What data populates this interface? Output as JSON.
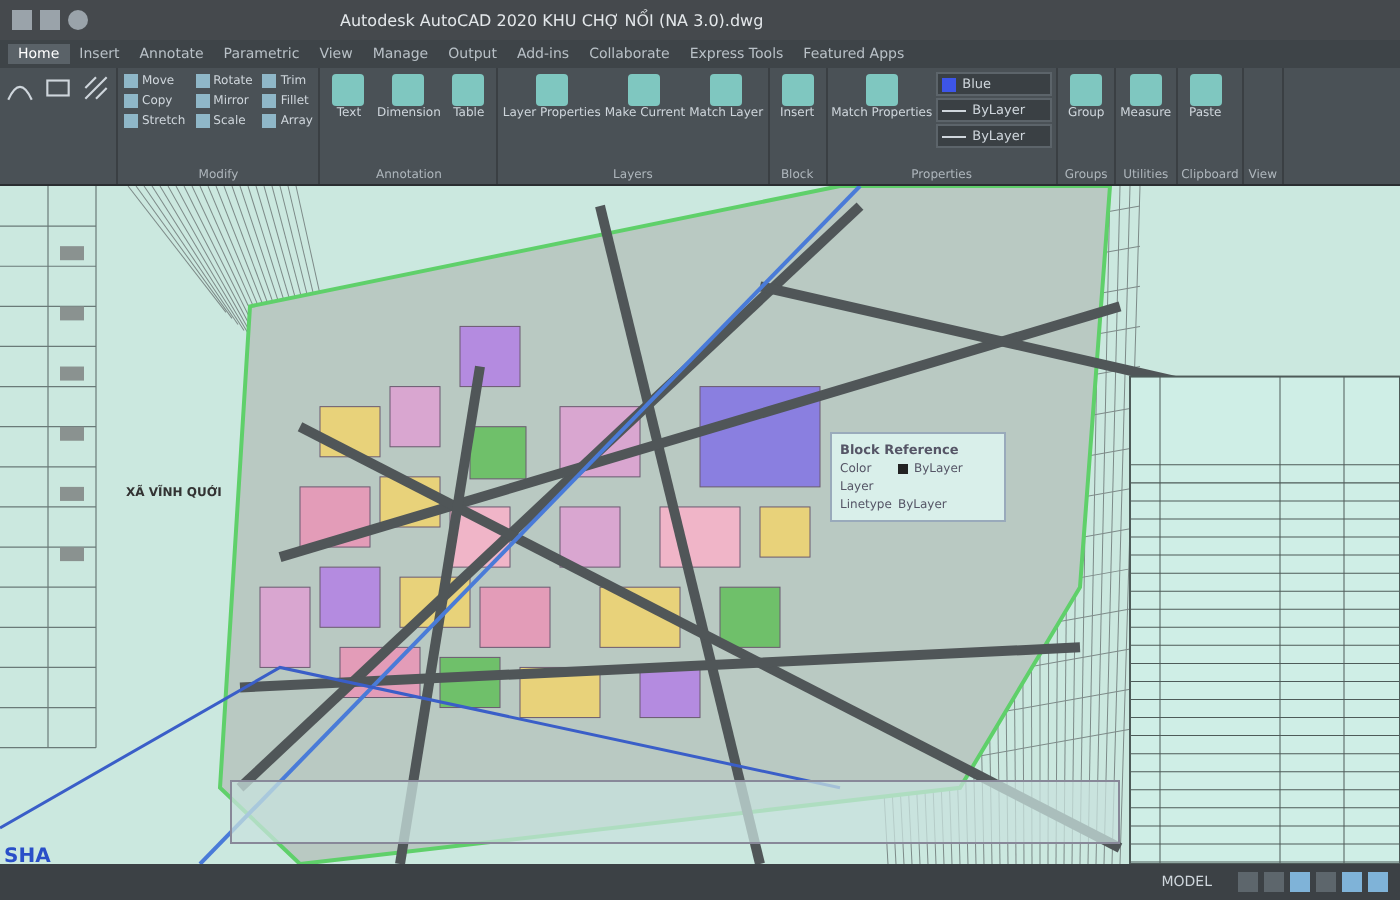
{
  "window": {
    "title": "Autodesk AutoCAD 2020   KHU CHỢ NỔI (NA 3.0).dwg"
  },
  "tabs": [
    {
      "label": "Home",
      "selected": true
    },
    {
      "label": "Insert",
      "selected": false
    },
    {
      "label": "Annotate",
      "selected": false
    },
    {
      "label": "Parametric",
      "selected": false
    },
    {
      "label": "View",
      "selected": false
    },
    {
      "label": "Manage",
      "selected": false
    },
    {
      "label": "Output",
      "selected": false
    },
    {
      "label": "Add-ins",
      "selected": false
    },
    {
      "label": "Collaborate",
      "selected": false
    },
    {
      "label": "Express Tools",
      "selected": false
    },
    {
      "label": "Featured Apps",
      "selected": false
    }
  ],
  "ribbon": {
    "panels": [
      {
        "label": "Modify",
        "kind": "small",
        "tools": [
          "Move",
          "Rotate",
          "Trim",
          "Copy",
          "Mirror",
          "Fillet",
          "Stretch",
          "Scale",
          "Array"
        ]
      },
      {
        "label": "Annotation",
        "kind": "large",
        "tools": [
          "Text",
          "Dimension",
          "Table"
        ]
      },
      {
        "label": "Layers",
        "kind": "large",
        "tools": [
          "Layer Properties",
          "Make Current",
          "Match Layer"
        ]
      },
      {
        "label": "Block",
        "kind": "large",
        "tools": [
          "Insert"
        ]
      },
      {
        "label": "Properties",
        "kind": "props",
        "tools": [
          "Match Properties"
        ],
        "dropdowns": [
          {
            "value": "Blue",
            "color": "#3d55e8"
          },
          {
            "value": "ByLayer"
          },
          {
            "value": "ByLayer"
          }
        ]
      },
      {
        "label": "Groups",
        "kind": "large",
        "tools": [
          "Group"
        ]
      },
      {
        "label": "Utilities",
        "kind": "large",
        "tools": [
          "Measure"
        ]
      },
      {
        "label": "Clipboard",
        "kind": "large",
        "tools": [
          "Paste"
        ]
      },
      {
        "label": "View",
        "kind": "large"
      }
    ]
  },
  "map_labels": [
    {
      "text": "XÃ VĨNH QUỚI"
    },
    {
      "text": "SHA"
    }
  ],
  "tooltip": {
    "title": "Block Reference",
    "rows": [
      {
        "label": "Color",
        "value": "ByLayer",
        "color": "#222222"
      },
      {
        "label": "Layer"
      },
      {
        "label": "Linetype",
        "value": "ByLayer"
      }
    ]
  },
  "status_bar": {
    "mode": "MODEL"
  }
}
